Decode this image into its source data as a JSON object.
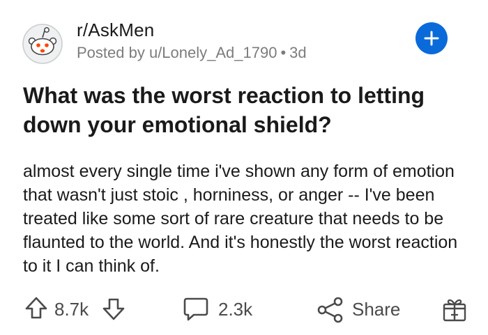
{
  "post": {
    "subreddit": "r/AskMen",
    "posted_by": "Posted by u/Lonely_Ad_1790",
    "separator": "•",
    "age": "3d",
    "title": "What was the worst reaction to letting down your emotional shield?",
    "body": "almost every single time i've shown any form of emotion that wasn't just stoic , horniness, or anger -- I've been treated like some sort of rare creature that needs to be flaunted to the world.  And it's honestly the worst reaction to it I can think of."
  },
  "actions": {
    "upvotes": "8.7k",
    "comments": "2.3k",
    "share_label": "Share"
  },
  "colors": {
    "accent": "#0a6ad9",
    "text": "#1a1a1b",
    "muted": "#7c7c7c",
    "icon": "#4a4a4a"
  },
  "icons": [
    "snoo-avatar",
    "plus-icon",
    "upvote-icon",
    "downvote-icon",
    "comment-icon",
    "share-icon",
    "award-icon"
  ]
}
